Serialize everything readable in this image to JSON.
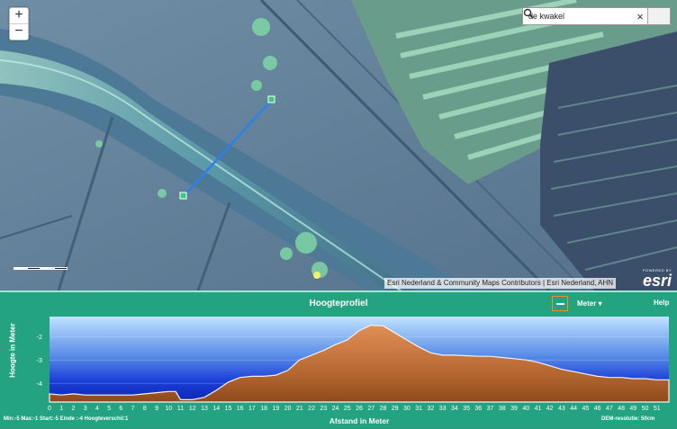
{
  "map": {
    "zoom_in": "+",
    "zoom_out": "−",
    "search": {
      "value": "de kwakel",
      "clear": "×"
    },
    "attribution": "Esri Nederland & Community Maps Contributors | Esri Nederland, AHN",
    "esri_powered": "POWERED BY",
    "esri_logo": "esri"
  },
  "panel": {
    "title": "Hoogteprofiel",
    "unit_label": "Meter ▾",
    "help": "Help",
    "stats": "Min:-5 Max:-1 Start:-5 Einde :-4 Hoogteverschil:1",
    "dem": "DEM-resolutie: 50cm"
  },
  "chart_data": {
    "type": "area",
    "title": "",
    "xlabel": "Afstand in Meter",
    "ylabel": "Hoogte in Meter",
    "xlim": [
      0,
      52
    ],
    "ylim": [
      -4.8,
      -1.15
    ],
    "x_ticks": [
      0,
      1,
      2,
      3,
      4,
      5,
      6,
      7,
      8,
      9,
      10,
      11,
      12,
      13,
      14,
      15,
      16,
      17,
      18,
      19,
      20,
      21,
      22,
      23,
      24,
      25,
      26,
      27,
      28,
      29,
      30,
      31,
      32,
      33,
      34,
      35,
      36,
      37,
      38,
      39,
      40,
      41,
      42,
      43,
      44,
      45,
      46,
      47,
      48,
      49,
      50,
      51
    ],
    "y_ticks": [
      -2,
      -3,
      -4
    ],
    "x": [
      0,
      1,
      2,
      3,
      4,
      5,
      6,
      7,
      8,
      9,
      10,
      10.6,
      11,
      12,
      13,
      14,
      15,
      16,
      17,
      18,
      19,
      20,
      21,
      22,
      23,
      24,
      25,
      26,
      27,
      28,
      29,
      30,
      31,
      32,
      33,
      34,
      35,
      36,
      37,
      38,
      39,
      40,
      41,
      42,
      43,
      44,
      45,
      46,
      47,
      48,
      49,
      50,
      51,
      52
    ],
    "y": [
      -4.45,
      -4.5,
      -4.45,
      -4.5,
      -4.5,
      -4.5,
      -4.5,
      -4.5,
      -4.45,
      -4.4,
      -4.35,
      -4.35,
      -4.7,
      -4.7,
      -4.6,
      -4.3,
      -3.95,
      -3.75,
      -3.7,
      -3.7,
      -3.65,
      -3.45,
      -3.0,
      -2.8,
      -2.6,
      -2.35,
      -2.15,
      -1.75,
      -1.52,
      -1.55,
      -1.85,
      -2.15,
      -2.45,
      -2.7,
      -2.8,
      -2.8,
      -2.82,
      -2.85,
      -2.85,
      -2.9,
      -2.95,
      -3.0,
      -3.1,
      -3.25,
      -3.4,
      -3.5,
      -3.6,
      -3.7,
      -3.75,
      -3.75,
      -3.8,
      -3.8,
      -3.85,
      -3.85
    ]
  }
}
